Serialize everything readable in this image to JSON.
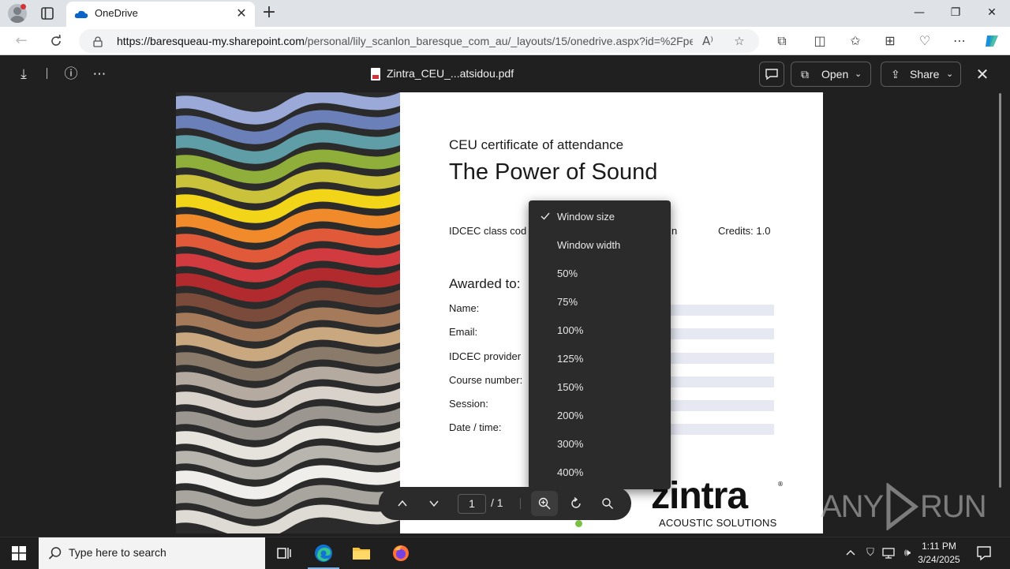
{
  "browser": {
    "tab_title": "OneDrive",
    "url_host": "https://baresqueau-my.sharepoint.com",
    "url_path": "/personal/lily_scanlon_baresque_com_au/_layouts/15/onedrive.aspx?id=%2Fpe...",
    "win_minimize": "—",
    "win_maximize": "❐",
    "win_close": "✕"
  },
  "viewer": {
    "file_name": "Zintra_CEU_...atsidou.pdf",
    "open_label": "Open",
    "share_label": "Share"
  },
  "certificate": {
    "subtitle": "CEU certificate of attendance",
    "title": "The Power of Sound",
    "class_code_label": "IDCEC class cod",
    "class_code_tail": "n",
    "credits": "Credits: 1.0",
    "awarded_to": "Awarded to:",
    "fields": [
      "Name:",
      "Email:",
      "IDCEC provider",
      "Course number:",
      "Session:",
      "Date / time:"
    ],
    "logo_word": "zintra",
    "logo_reg": "®",
    "logo_sub": "ACOUSTIC SOLUTIONS"
  },
  "zoom_menu": {
    "items": [
      "Window size",
      "Window width",
      "50%",
      "75%",
      "100%",
      "125%",
      "150%",
      "200%",
      "300%",
      "400%"
    ],
    "selected": "Window size"
  },
  "page_toolbar": {
    "current_page": "1",
    "total_pages": "/ 1"
  },
  "taskbar": {
    "search_placeholder": "Type here to search",
    "time": "1:11 PM",
    "date": "3/24/2025"
  },
  "watermark": {
    "left": "ANY",
    "right": "RUN"
  },
  "colors": {
    "viewer_bg": "#202020",
    "menu_bg": "#2b2b2b",
    "edge_accent": "#0078d4",
    "field_fill": "#e6e8f2",
    "logo_green": "#7ac143"
  }
}
